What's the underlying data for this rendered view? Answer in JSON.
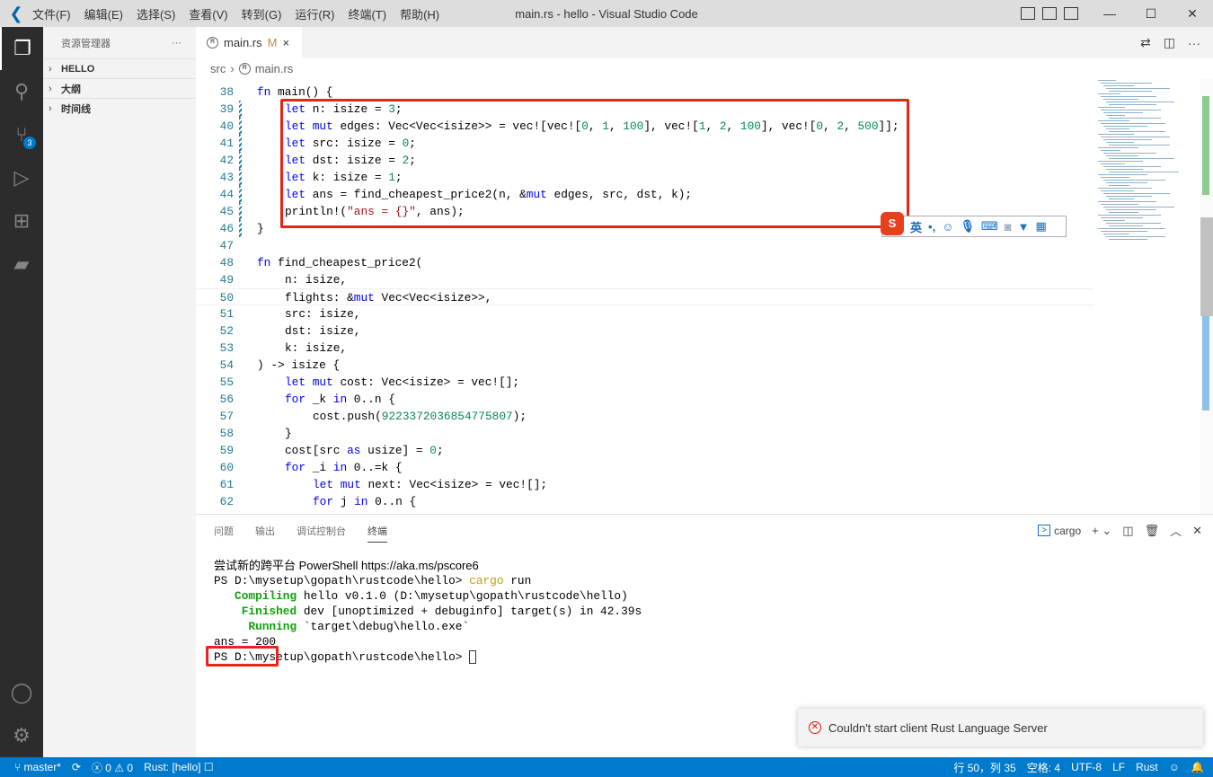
{
  "window": {
    "title": "main.rs - hello - Visual Studio Code",
    "menu": [
      "文件(F)",
      "编辑(E)",
      "选择(S)",
      "查看(V)",
      "转到(G)",
      "运行(R)",
      "终端(T)",
      "帮助(H)"
    ],
    "controls": {
      "minimize": "—",
      "maximize": "☐",
      "close": "✕"
    }
  },
  "activity": {
    "scm_badge": "3",
    "items": [
      "explorer-icon",
      "search-icon",
      "source-control-icon",
      "run-debug-icon",
      "extensions-icon",
      "docker-icon",
      "account-icon",
      "gear-icon"
    ]
  },
  "sidebar": {
    "title": "资源管理器",
    "more": "···",
    "sections": [
      "HELLO",
      "大纲",
      "时间线"
    ]
  },
  "tab": {
    "label": "main.rs",
    "modified": "M",
    "close": "×"
  },
  "breadcrumb": {
    "folder": "src",
    "file": "main.rs"
  },
  "editor": {
    "lines": [
      {
        "n": "38",
        "i": 0,
        "tk": [
          [
            "k",
            "fn"
          ],
          [
            "t",
            " main() {"
          ]
        ]
      },
      {
        "n": "39",
        "i": 1,
        "tk": [
          [
            "k",
            "let"
          ],
          [
            "t",
            " n: isize = "
          ],
          [
            "n",
            "3"
          ],
          [
            "t",
            ";"
          ]
        ]
      },
      {
        "n": "40",
        "i": 1,
        "tk": [
          [
            "k",
            "let mut"
          ],
          [
            "t",
            " edges: Vec<Vec<isize>> = vec![vec!["
          ],
          [
            "n",
            "0"
          ],
          [
            "t",
            ", "
          ],
          [
            "n",
            "1"
          ],
          [
            "t",
            ", "
          ],
          [
            "n",
            "100"
          ],
          [
            "t",
            "], vec!["
          ],
          [
            "n",
            "1"
          ],
          [
            "t",
            ", "
          ],
          [
            "n",
            "2"
          ],
          [
            "t",
            ", "
          ],
          [
            "n",
            "100"
          ],
          [
            "t",
            "], vec!["
          ],
          [
            "n",
            "0"
          ],
          [
            "t",
            ", "
          ],
          [
            "n",
            "2"
          ],
          [
            "t",
            ", "
          ],
          [
            "n",
            "500"
          ],
          [
            "t",
            "]];"
          ]
        ]
      },
      {
        "n": "41",
        "i": 1,
        "tk": [
          [
            "k",
            "let"
          ],
          [
            "t",
            " src: isize = "
          ],
          [
            "n",
            "0"
          ],
          [
            "t",
            ";"
          ]
        ]
      },
      {
        "n": "42",
        "i": 1,
        "tk": [
          [
            "k",
            "let"
          ],
          [
            "t",
            " dst: isize = "
          ],
          [
            "n",
            "2"
          ],
          [
            "t",
            ";"
          ]
        ]
      },
      {
        "n": "43",
        "i": 1,
        "tk": [
          [
            "k",
            "let"
          ],
          [
            "t",
            " k: isize = "
          ],
          [
            "n",
            "1"
          ],
          [
            "t",
            ";"
          ]
        ]
      },
      {
        "n": "44",
        "i": 1,
        "tk": [
          [
            "k",
            "let"
          ],
          [
            "t",
            " ans = find_cheapest_price2(n, &"
          ],
          [
            "k",
            "mut"
          ],
          [
            "t",
            " edges, src, dst, k);"
          ]
        ]
      },
      {
        "n": "45",
        "i": 1,
        "tk": [
          [
            "t",
            "println!("
          ],
          [
            "s",
            "\"ans = {}\""
          ],
          [
            "t",
            ", ans);"
          ]
        ]
      },
      {
        "n": "46",
        "i": 0,
        "tk": [
          [
            "t",
            "}"
          ]
        ]
      },
      {
        "n": "47",
        "i": 0,
        "tk": []
      },
      {
        "n": "48",
        "i": 0,
        "tk": [
          [
            "k",
            "fn"
          ],
          [
            "t",
            " find_cheapest_price2("
          ]
        ]
      },
      {
        "n": "49",
        "i": 1,
        "tk": [
          [
            "t",
            "n: isize,"
          ]
        ]
      },
      {
        "n": "50",
        "i": 1,
        "tk": [
          [
            "t",
            "flights: &"
          ],
          [
            "k",
            "mut"
          ],
          [
            "t",
            " Vec<Vec<isize>>,"
          ]
        ]
      },
      {
        "n": "51",
        "i": 1,
        "tk": [
          [
            "t",
            "src: isize,"
          ]
        ]
      },
      {
        "n": "52",
        "i": 1,
        "tk": [
          [
            "t",
            "dst: isize,"
          ]
        ]
      },
      {
        "n": "53",
        "i": 1,
        "tk": [
          [
            "t",
            "k: isize,"
          ]
        ]
      },
      {
        "n": "54",
        "i": 0,
        "tk": [
          [
            "t",
            ") -> isize {"
          ]
        ]
      },
      {
        "n": "55",
        "i": 1,
        "tk": [
          [
            "k",
            "let mut"
          ],
          [
            "t",
            " cost: Vec<isize> = vec![];"
          ]
        ]
      },
      {
        "n": "56",
        "i": 1,
        "tk": [
          [
            "k",
            "for"
          ],
          [
            "t",
            " _k "
          ],
          [
            "k",
            "in"
          ],
          [
            "t",
            " 0..n {"
          ]
        ]
      },
      {
        "n": "57",
        "i": 2,
        "tk": [
          [
            "t",
            "cost.push("
          ],
          [
            "n",
            "9223372036854775807"
          ],
          [
            "t",
            ");"
          ]
        ]
      },
      {
        "n": "58",
        "i": 1,
        "tk": [
          [
            "t",
            "}"
          ]
        ]
      },
      {
        "n": "59",
        "i": 1,
        "tk": [
          [
            "t",
            "cost[src "
          ],
          [
            "k",
            "as"
          ],
          [
            "t",
            " usize] = "
          ],
          [
            "n",
            "0"
          ],
          [
            "t",
            ";"
          ]
        ]
      },
      {
        "n": "60",
        "i": 1,
        "tk": [
          [
            "k",
            "for"
          ],
          [
            "t",
            " _i "
          ],
          [
            "k",
            "in"
          ],
          [
            "t",
            " 0..=k {"
          ]
        ]
      },
      {
        "n": "61",
        "i": 2,
        "tk": [
          [
            "k",
            "let mut"
          ],
          [
            "t",
            " next: Vec<isize> = vec![];"
          ]
        ]
      },
      {
        "n": "62",
        "i": 2,
        "tk": [
          [
            "k",
            "for"
          ],
          [
            "t",
            " j "
          ],
          [
            "k",
            "in"
          ],
          [
            "t",
            " 0..n {"
          ]
        ]
      }
    ]
  },
  "ime_toolbar": {
    "logo": "S",
    "lang": "英",
    "punct": "•,",
    "items": [
      "emoji-icon",
      "microphone-icon",
      "keyboard-icon",
      "user-card-icon",
      "shirt-icon",
      "grid-icon"
    ]
  },
  "panel": {
    "tabs": [
      "问题",
      "输出",
      "调试控制台",
      "终端"
    ],
    "active": "终端",
    "shell": "cargo",
    "terminal": [
      [
        [
          "t",
          "尝试新的跨平台 PowerShell https://aka.ms/pscore6"
        ]
      ],
      [
        [
          "t",
          ""
        ]
      ],
      [
        [
          "t",
          "PS D:\\mysetup\\gopath\\rustcode\\hello> "
        ],
        [
          "y",
          "cargo"
        ],
        [
          "t",
          " run"
        ]
      ],
      [
        [
          "g",
          "   Compiling"
        ],
        [
          "t",
          " hello v0.1.0 (D:\\mysetup\\gopath\\rustcode\\hello)"
        ]
      ],
      [
        [
          "g",
          "    Finished"
        ],
        [
          "t",
          " dev [unoptimized + debuginfo] target(s) in 42.39s"
        ]
      ],
      [
        [
          "g",
          "     Running"
        ],
        [
          "t",
          " `target\\debug\\hello.exe`"
        ]
      ],
      [
        [
          "t",
          "ans = 200"
        ]
      ],
      [
        [
          "t",
          "PS D:\\mysetup\\gopath\\rustcode\\hello> "
        ]
      ]
    ]
  },
  "notification": {
    "message": "Couldn't start client Rust Language Server"
  },
  "status": {
    "branch": "master*",
    "errors": "0",
    "warnings": "0",
    "rust": "Rust: [hello]",
    "position": "行 50，列 35",
    "spaces": "空格: 4",
    "encoding": "UTF-8",
    "eol": "LF",
    "language": "Rust"
  },
  "colors": {
    "accent": "#007acc",
    "highlight_box": "#e8231a",
    "activity_bar": "#2c2c2c"
  }
}
